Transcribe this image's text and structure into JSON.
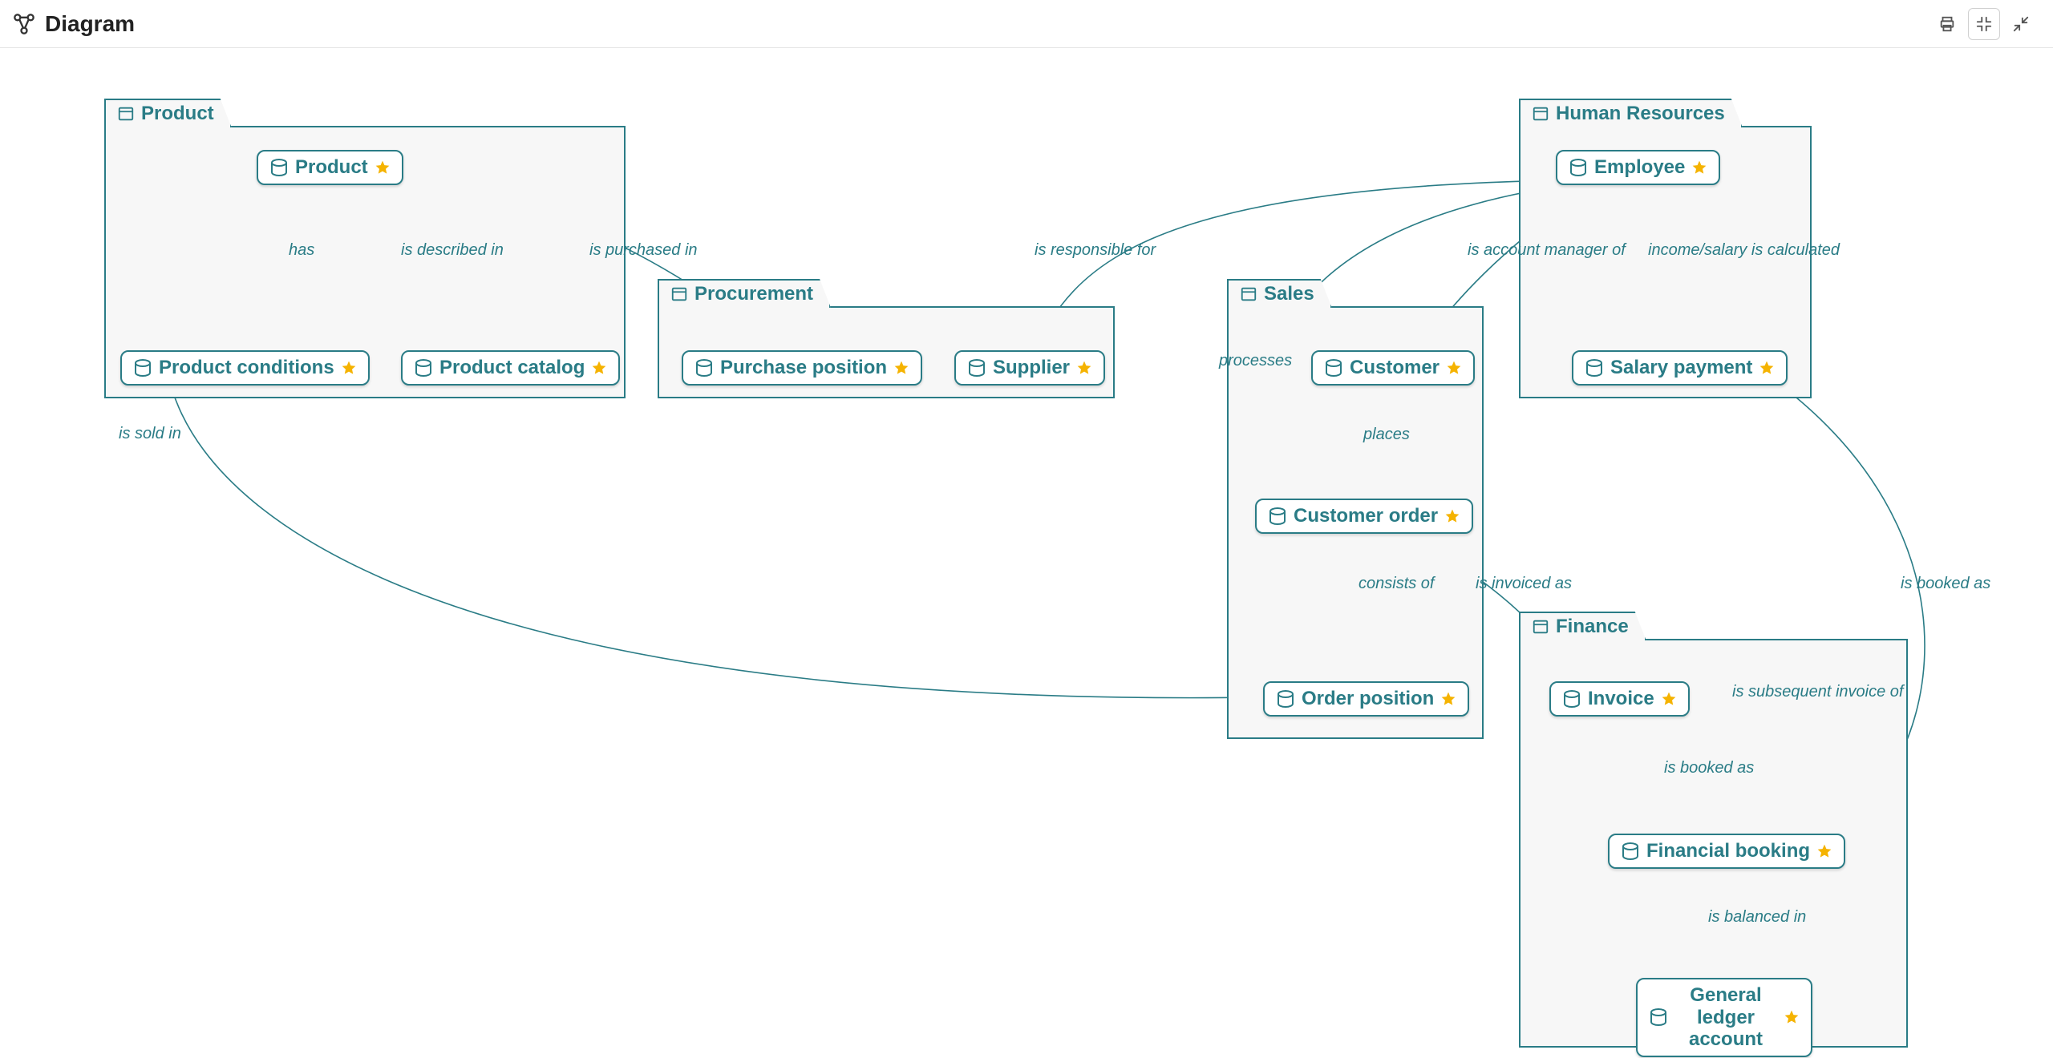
{
  "toolbar": {
    "title": "Diagram"
  },
  "packages": {
    "product": {
      "label": "Product"
    },
    "procurement": {
      "label": "Procurement"
    },
    "sales": {
      "label": "Sales"
    },
    "human_resources": {
      "label": "Human Resources"
    },
    "finance": {
      "label": "Finance"
    }
  },
  "nodes": {
    "product": {
      "label": "Product"
    },
    "product_conditions": {
      "label": "Product conditions"
    },
    "product_catalog": {
      "label": "Product catalog"
    },
    "purchase_position": {
      "label": "Purchase position"
    },
    "supplier": {
      "label": "Supplier"
    },
    "customer": {
      "label": "Customer"
    },
    "customer_order": {
      "label": "Customer order"
    },
    "order_position": {
      "label": "Order position"
    },
    "employee": {
      "label": "Employee"
    },
    "salary_payment": {
      "label": "Salary payment"
    },
    "invoice": {
      "label": "Invoice"
    },
    "financial_booking": {
      "label": "Financial booking"
    },
    "general_ledger": {
      "label": "General ledger account"
    }
  },
  "edges": {
    "has": {
      "label": "has"
    },
    "is_described_in": {
      "label": "is described in"
    },
    "is_purchased_in": {
      "label": "is purchased in"
    },
    "is_sold_in": {
      "label": "is sold in"
    },
    "is_responsible_for": {
      "label": "is responsible for"
    },
    "is_account_mgr": {
      "label": "is account manager of"
    },
    "income_salary": {
      "label": "income/salary is calculated"
    },
    "processes": {
      "label": "processes"
    },
    "places": {
      "label": "places"
    },
    "consists_of": {
      "label": "consists of"
    },
    "is_invoiced_as": {
      "label": "is invoiced as"
    },
    "is_subsequent": {
      "label": "is subsequent invoice of"
    },
    "is_booked_as_inv": {
      "label": "is booked as"
    },
    "is_booked_as_sal": {
      "label": "is booked as"
    },
    "is_balanced_in": {
      "label": "is balanced in"
    }
  }
}
